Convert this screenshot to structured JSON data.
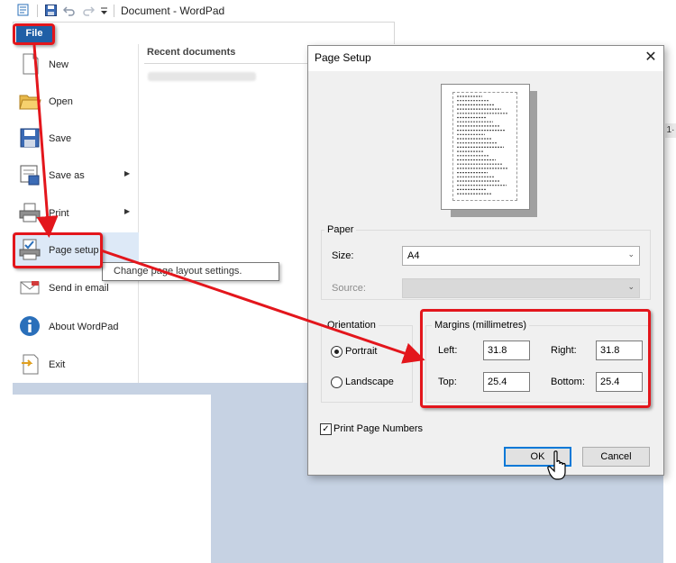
{
  "window": {
    "title": "Document - WordPad",
    "quick_access_icons": [
      "wordpad-icon",
      "save-icon",
      "undo-icon",
      "redo-icon",
      "customize-dropdown-icon"
    ]
  },
  "file_tab": {
    "label": "File"
  },
  "file_menu": {
    "items": [
      {
        "label": "New",
        "icon": "new-document-icon",
        "has_submenu": false
      },
      {
        "label": "Open",
        "icon": "open-folder-icon",
        "has_submenu": false
      },
      {
        "label": "Save",
        "icon": "save-disk-icon",
        "has_submenu": false
      },
      {
        "label": "Save as",
        "icon": "save-as-icon",
        "has_submenu": true
      },
      {
        "label": "Print",
        "icon": "printer-icon",
        "has_submenu": true
      },
      {
        "label": "Page setup",
        "icon": "page-setup-icon",
        "has_submenu": false
      },
      {
        "label": "Send in email",
        "icon": "email-icon",
        "has_submenu": false
      },
      {
        "label": "About WordPad",
        "icon": "info-icon",
        "has_submenu": false
      },
      {
        "label": "Exit",
        "icon": "exit-icon",
        "has_submenu": false
      }
    ],
    "recent_title": "Recent documents",
    "tooltip": "Change page layout settings."
  },
  "page_setup_dialog": {
    "title": "Page Setup",
    "paper": {
      "group_label": "Paper",
      "size_label": "Size:",
      "size_value": "A4",
      "source_label": "Source:",
      "source_value": ""
    },
    "orientation": {
      "group_label": "Orientation",
      "portrait_label": "Portrait",
      "landscape_label": "Landscape",
      "selected": "Portrait"
    },
    "margins": {
      "group_label": "Margins (millimetres)",
      "left_label": "Left:",
      "left_value": "31.8",
      "right_label": "Right:",
      "right_value": "31.8",
      "top_label": "Top:",
      "top_value": "25.4",
      "bottom_label": "Bottom:",
      "bottom_value": "25.4"
    },
    "print_page_numbers_label": "Print Page Numbers",
    "print_page_numbers_checked": true,
    "ok_label": "OK",
    "cancel_label": "Cancel"
  },
  "annotations": {
    "highlight_color": "#e3161c"
  },
  "theme": {
    "file_tab_color": "#1f5fa6",
    "hover_color": "#dde9f7",
    "doc_background": "#c6d2e3"
  }
}
